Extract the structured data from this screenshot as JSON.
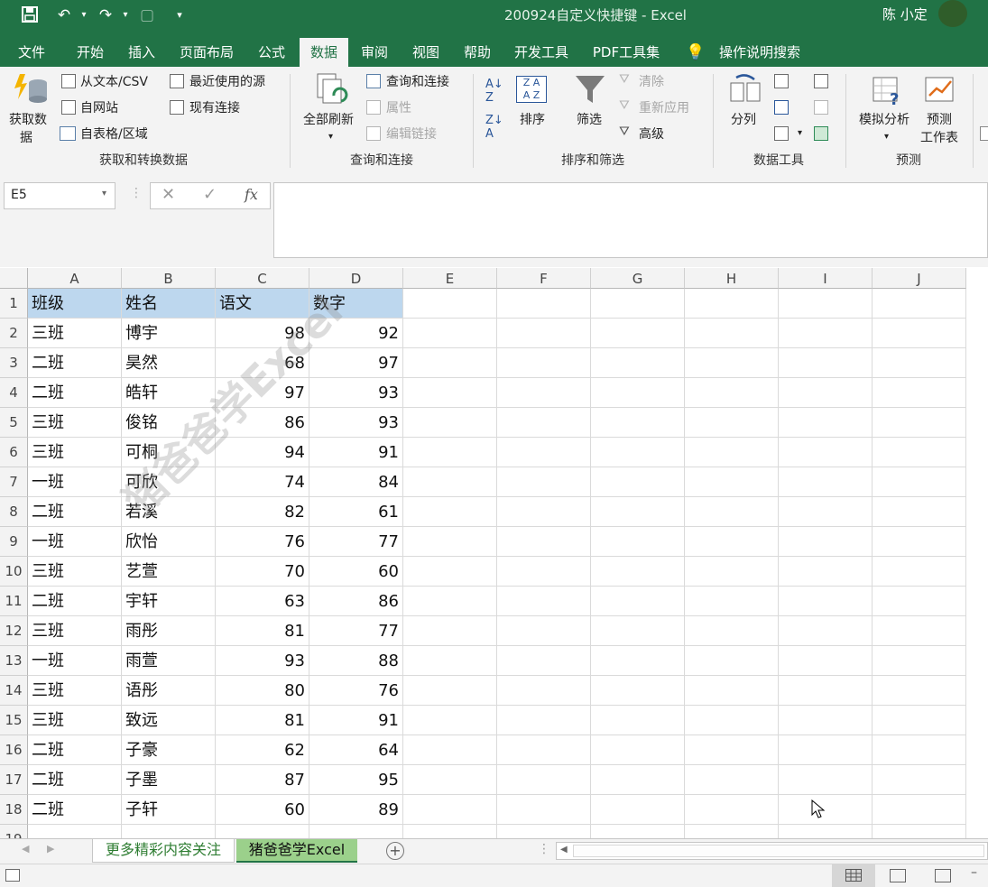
{
  "app": {
    "window_title": "200924自定义快捷键 - Excel",
    "user": "陈 小定"
  },
  "ribbon_tabs": [
    "文件",
    "开始",
    "插入",
    "页面布局",
    "公式",
    "数据",
    "审阅",
    "视图",
    "帮助",
    "开发工具",
    "PDF工具集"
  ],
  "active_tab": "数据",
  "tell_me": "操作说明搜索",
  "ribbon": {
    "get_data": {
      "get_data_btn_l1": "获取数",
      "get_data_btn_l2": "据",
      "from_text": "从文本/CSV",
      "from_web": "自网站",
      "from_table": "自表格/区域",
      "recent_sources": "最近使用的源",
      "existing_conn": "现有连接",
      "group": "获取和转换数据"
    },
    "queries": {
      "refresh_all": "全部刷新",
      "queries_conn": "查询和连接",
      "properties": "属性",
      "edit_links": "编辑链接",
      "group": "查询和连接"
    },
    "sort_filter": {
      "sort": "排序",
      "filter": "筛选",
      "clear": "清除",
      "reapply": "重新应用",
      "advanced": "高级",
      "group": "排序和筛选"
    },
    "data_tools": {
      "text_to_columns": "分列",
      "group": "数据工具"
    },
    "forecast": {
      "what_if": "模拟分析",
      "forecast_sheet_l1": "预测",
      "forecast_sheet_l2": "工作表",
      "group": "预测"
    }
  },
  "formula_bar": {
    "name_box": "E5",
    "fx": "fx",
    "content": ""
  },
  "columns": [
    "A",
    "B",
    "C",
    "D",
    "E",
    "F",
    "G",
    "H",
    "I",
    "J"
  ],
  "table": {
    "headers": [
      "班级",
      "姓名",
      "语文",
      "数字"
    ],
    "rows": [
      [
        "三班",
        "博宇",
        "98",
        "92"
      ],
      [
        "二班",
        "昊然",
        "68",
        "97"
      ],
      [
        "二班",
        "皓轩",
        "97",
        "93"
      ],
      [
        "三班",
        "俊铭",
        "86",
        "93"
      ],
      [
        "三班",
        "可桐",
        "94",
        "91"
      ],
      [
        "一班",
        "可欣",
        "74",
        "84"
      ],
      [
        "二班",
        "若溪",
        "82",
        "61"
      ],
      [
        "一班",
        "欣怡",
        "76",
        "77"
      ],
      [
        "三班",
        "艺萱",
        "70",
        "60"
      ],
      [
        "二班",
        "宇轩",
        "63",
        "86"
      ],
      [
        "三班",
        "雨彤",
        "81",
        "77"
      ],
      [
        "一班",
        "雨萱",
        "93",
        "88"
      ],
      [
        "三班",
        "语彤",
        "80",
        "76"
      ],
      [
        "三班",
        "致远",
        "81",
        "91"
      ],
      [
        "二班",
        "子豪",
        "62",
        "64"
      ],
      [
        "二班",
        "子墨",
        "87",
        "95"
      ],
      [
        "二班",
        "子轩",
        "60",
        "89"
      ]
    ]
  },
  "watermark": "猪爸爸学Excel",
  "sheets": [
    "更多精彩内容关注",
    "猪爸爸学Excel"
  ],
  "active_sheet": 1,
  "colors": {
    "excel_green": "#217346",
    "header_fill": "#bdd7ee",
    "sheet_tab_active": "#9bd08b"
  }
}
